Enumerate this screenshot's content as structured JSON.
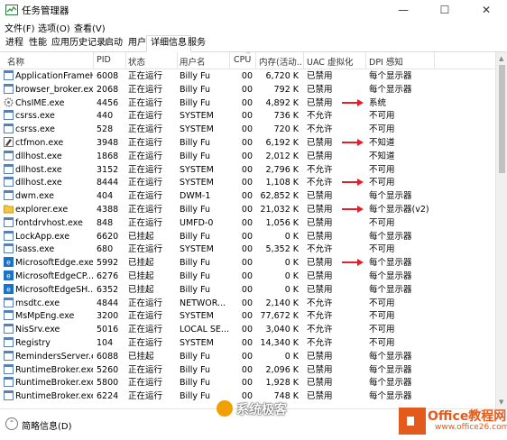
{
  "window": {
    "title": "任务管理器",
    "min": "—",
    "max": "☐",
    "close": "✕"
  },
  "menu": [
    "文件(F)",
    "选项(O)",
    "查看(V)"
  ],
  "tabs": [
    "进程",
    "性能",
    "应用历史记录",
    "启动",
    "用户",
    "详细信息",
    "服务"
  ],
  "active_tab": 5,
  "columns": {
    "name": "名称",
    "pid": "PID",
    "status": "状态",
    "user": "用户名",
    "cpu": "CPU",
    "mem": "内存(活动...",
    "uac": "UAC 虚拟化",
    "dpi": "DPI 感知"
  },
  "rows": [
    {
      "name": "ApplicationFrameH...",
      "pid": "6008",
      "status": "正在运行",
      "user": "Billy Fu",
      "cpu": "00",
      "mem": "6,720 K",
      "uac": "已禁用",
      "dpi": "每个显示器",
      "icon": "window",
      "arrow": false
    },
    {
      "name": "browser_broker.exe",
      "pid": "2068",
      "status": "正在运行",
      "user": "Billy Fu",
      "cpu": "00",
      "mem": "792 K",
      "uac": "已禁用",
      "dpi": "每个显示器",
      "icon": "window",
      "arrow": false
    },
    {
      "name": "ChsIME.exe",
      "pid": "4456",
      "status": "正在运行",
      "user": "Billy Fu",
      "cpu": "00",
      "mem": "4,892 K",
      "uac": "已禁用",
      "dpi": "系统",
      "icon": "gear",
      "arrow": true
    },
    {
      "name": "csrss.exe",
      "pid": "440",
      "status": "正在运行",
      "user": "SYSTEM",
      "cpu": "00",
      "mem": "736 K",
      "uac": "不允许",
      "dpi": "不可用",
      "icon": "window",
      "arrow": false
    },
    {
      "name": "csrss.exe",
      "pid": "528",
      "status": "正在运行",
      "user": "SYSTEM",
      "cpu": "00",
      "mem": "720 K",
      "uac": "不允许",
      "dpi": "不可用",
      "icon": "window",
      "arrow": false
    },
    {
      "name": "ctfmon.exe",
      "pid": "3948",
      "status": "正在运行",
      "user": "Billy Fu",
      "cpu": "00",
      "mem": "6,192 K",
      "uac": "已禁用",
      "dpi": "不知道",
      "icon": "pen",
      "arrow": true
    },
    {
      "name": "dllhost.exe",
      "pid": "1868",
      "status": "正在运行",
      "user": "Billy Fu",
      "cpu": "00",
      "mem": "2,012 K",
      "uac": "已禁用",
      "dpi": "不知道",
      "icon": "window",
      "arrow": false
    },
    {
      "name": "dllhost.exe",
      "pid": "3152",
      "status": "正在运行",
      "user": "SYSTEM",
      "cpu": "00",
      "mem": "2,796 K",
      "uac": "不允许",
      "dpi": "不可用",
      "icon": "window",
      "arrow": false
    },
    {
      "name": "dllhost.exe",
      "pid": "8444",
      "status": "正在运行",
      "user": "SYSTEM",
      "cpu": "00",
      "mem": "1,108 K",
      "uac": "不允许",
      "dpi": "不可用",
      "icon": "window",
      "arrow": true
    },
    {
      "name": "dwm.exe",
      "pid": "404",
      "status": "正在运行",
      "user": "DWM-1",
      "cpu": "00",
      "mem": "62,852 K",
      "uac": "已禁用",
      "dpi": "每个显示器",
      "icon": "window",
      "arrow": false
    },
    {
      "name": "explorer.exe",
      "pid": "4388",
      "status": "正在运行",
      "user": "Billy Fu",
      "cpu": "00",
      "mem": "21,032 K",
      "uac": "已禁用",
      "dpi": "每个显示器(v2)",
      "icon": "folder",
      "arrow": true
    },
    {
      "name": "fontdrvhost.exe",
      "pid": "848",
      "status": "正在运行",
      "user": "UMFD-0",
      "cpu": "00",
      "mem": "1,056 K",
      "uac": "已禁用",
      "dpi": "不可用",
      "icon": "window",
      "arrow": false
    },
    {
      "name": "LockApp.exe",
      "pid": "6620",
      "status": "已挂起",
      "user": "Billy Fu",
      "cpu": "00",
      "mem": "0 K",
      "uac": "已禁用",
      "dpi": "每个显示器",
      "icon": "window",
      "arrow": false
    },
    {
      "name": "lsass.exe",
      "pid": "680",
      "status": "正在运行",
      "user": "SYSTEM",
      "cpu": "00",
      "mem": "5,352 K",
      "uac": "不允许",
      "dpi": "不可用",
      "icon": "window",
      "arrow": false
    },
    {
      "name": "MicrosoftEdge.exe",
      "pid": "5992",
      "status": "已挂起",
      "user": "Billy Fu",
      "cpu": "00",
      "mem": "0 K",
      "uac": "已禁用",
      "dpi": "每个显示器",
      "icon": "edge",
      "arrow": true
    },
    {
      "name": "MicrosoftEdgeCP....",
      "pid": "6276",
      "status": "已挂起",
      "user": "Billy Fu",
      "cpu": "00",
      "mem": "0 K",
      "uac": "已禁用",
      "dpi": "每个显示器",
      "icon": "edge",
      "arrow": false
    },
    {
      "name": "MicrosoftEdgeSH....",
      "pid": "6352",
      "status": "已挂起",
      "user": "Billy Fu",
      "cpu": "00",
      "mem": "0 K",
      "uac": "已禁用",
      "dpi": "每个显示器",
      "icon": "edge",
      "arrow": false
    },
    {
      "name": "msdtc.exe",
      "pid": "4844",
      "status": "正在运行",
      "user": "NETWOR...",
      "cpu": "00",
      "mem": "2,140 K",
      "uac": "不允许",
      "dpi": "不可用",
      "icon": "window",
      "arrow": false
    },
    {
      "name": "MsMpEng.exe",
      "pid": "3200",
      "status": "正在运行",
      "user": "SYSTEM",
      "cpu": "00",
      "mem": "77,672 K",
      "uac": "不允许",
      "dpi": "不可用",
      "icon": "window",
      "arrow": false
    },
    {
      "name": "NisSrv.exe",
      "pid": "5016",
      "status": "正在运行",
      "user": "LOCAL SE...",
      "cpu": "00",
      "mem": "3,040 K",
      "uac": "不允许",
      "dpi": "不可用",
      "icon": "window",
      "arrow": false
    },
    {
      "name": "Registry",
      "pid": "104",
      "status": "正在运行",
      "user": "SYSTEM",
      "cpu": "00",
      "mem": "14,340 K",
      "uac": "不允许",
      "dpi": "不可用",
      "icon": "window",
      "arrow": false
    },
    {
      "name": "RemindersServer.e...",
      "pid": "6088",
      "status": "已挂起",
      "user": "Billy Fu",
      "cpu": "00",
      "mem": "0 K",
      "uac": "已禁用",
      "dpi": "每个显示器",
      "icon": "window",
      "arrow": false
    },
    {
      "name": "RuntimeBroker.exe",
      "pid": "5260",
      "status": "正在运行",
      "user": "Billy Fu",
      "cpu": "00",
      "mem": "2,096 K",
      "uac": "已禁用",
      "dpi": "每个显示器",
      "icon": "window",
      "arrow": false
    },
    {
      "name": "RuntimeBroker.exe",
      "pid": "5800",
      "status": "正在运行",
      "user": "Billy Fu",
      "cpu": "00",
      "mem": "1,928 K",
      "uac": "已禁用",
      "dpi": "每个显示器",
      "icon": "window",
      "arrow": false
    },
    {
      "name": "RuntimeBroker.exe",
      "pid": "6224",
      "status": "正在运行",
      "user": "Billy Fu",
      "cpu": "00",
      "mem": "748 K",
      "uac": "已禁用",
      "dpi": "每个显示器",
      "icon": "window",
      "arrow": false
    }
  ],
  "footer": {
    "fewer_details": "简略信息(D)"
  },
  "watermarks": {
    "left": "系统极客",
    "right": "Office教程网",
    "right_sub": "www.office26.com"
  },
  "colors": {
    "accent": "#0078d7",
    "arrow": "#e0202a"
  }
}
